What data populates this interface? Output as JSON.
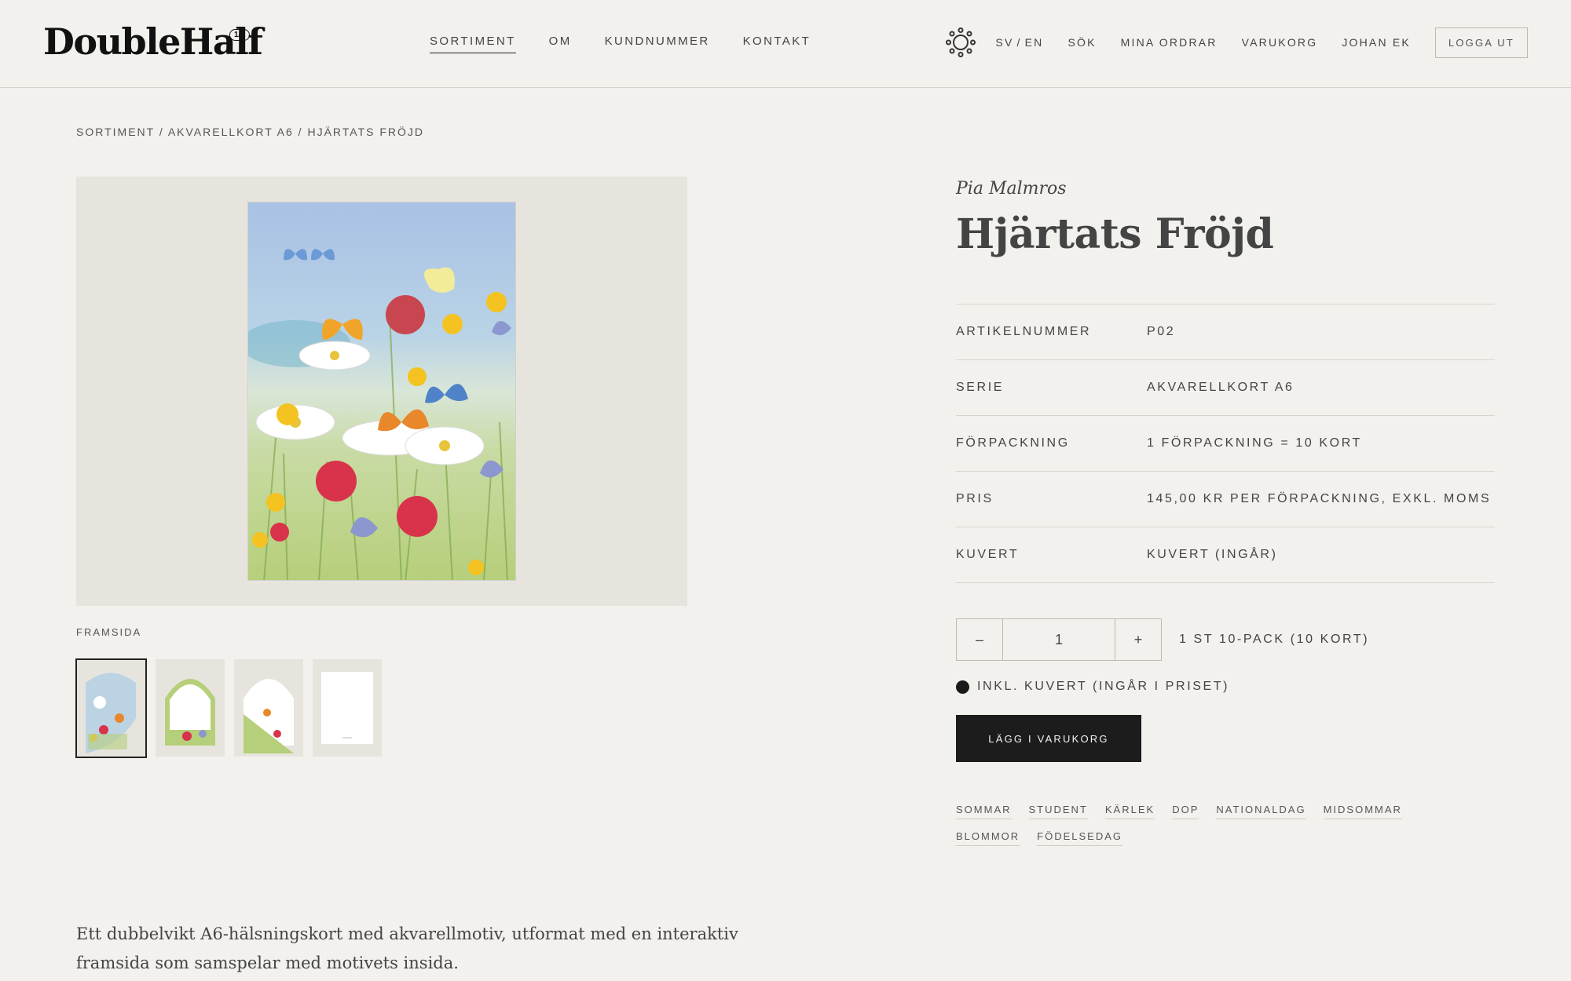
{
  "header": {
    "logo": "DoubleHalf",
    "logo_badge": "1/1",
    "nav": [
      "SORTIMENT",
      "OM",
      "KUNDNUMMER",
      "KONTAKT"
    ],
    "lang_sv": "SV",
    "lang_sep": "/",
    "lang_en": "EN",
    "search": "SÖK",
    "orders": "MINA ORDRAR",
    "cart": "VARUKORG",
    "user": "JOHAN EK",
    "logout": "LOGGA UT"
  },
  "breadcrumb": "SORTIMENT / AKVARELLKORT A6 / HJÄRTATS FRÖJD",
  "gallery": {
    "caption": "FRAMSIDA"
  },
  "product": {
    "artist": "Pia Malmros",
    "title": "Hjärtats Fröjd",
    "specs": [
      {
        "key": "ARTIKELNUMMER",
        "value": "P02"
      },
      {
        "key": "SERIE",
        "value": "AKVARELLKORT A6"
      },
      {
        "key": "FÖRPACKNING",
        "value": "1 FÖRPACKNING = 10 KORT"
      },
      {
        "key": "PRIS",
        "value": "145,00 KR PER FÖRPACKNING, EXKL. MOMS"
      },
      {
        "key": "KUVERT",
        "value": "KUVERT (INGÅR)"
      }
    ],
    "qty_minus": "–",
    "qty_value": "1",
    "qty_plus": "+",
    "qty_label": "1 ST 10-PACK (10 KORT)",
    "envelope_option": "INKL. KUVERT (INGÅR I PRISET)",
    "add_to_cart": "LÄGG I VARUKORG",
    "tags": [
      "SOMMAR",
      "STUDENT",
      "KÄRLEK",
      "DOP",
      "NATIONALDAG",
      "MIDSOMMAR",
      "BLOMMOR",
      "FÖDELSEDAG"
    ]
  },
  "description": "Ett dubbelvikt A6-hälsningskort med akvarellmotiv, utformat med en interaktiv framsida som samspelar med motivets insida."
}
